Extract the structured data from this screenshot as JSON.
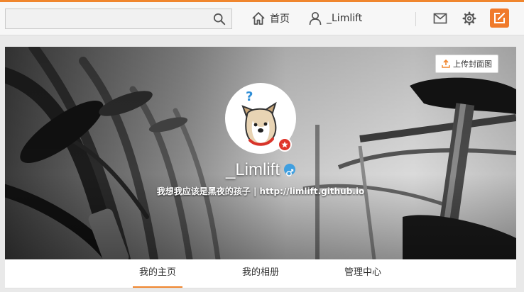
{
  "header": {
    "search": {
      "value": "",
      "placeholder": ""
    },
    "home_label": "首页",
    "user_label": "_Limlift"
  },
  "cover": {
    "upload_label": "上传封面图",
    "username": "_Limlift",
    "bio": "我想我应该是黑夜的孩子 | http://limlift.github.io"
  },
  "tabs": [
    {
      "label": "我的主页",
      "active": true
    },
    {
      "label": "我的相册",
      "active": false
    },
    {
      "label": "管理中心",
      "active": false
    }
  ],
  "icons": {
    "search": "search-icon",
    "home": "home-icon",
    "user": "user-icon",
    "mail": "mail-icon",
    "settings": "gear-icon",
    "compose": "compose-icon",
    "upload": "upload-icon",
    "gender": "male-icon",
    "badge": "star-badge-icon"
  },
  "colors": {
    "accent": "#f0862e",
    "compose_bg": "#f07a2b",
    "badge_red": "#e0352b",
    "gender_blue": "#3f9fe0"
  }
}
